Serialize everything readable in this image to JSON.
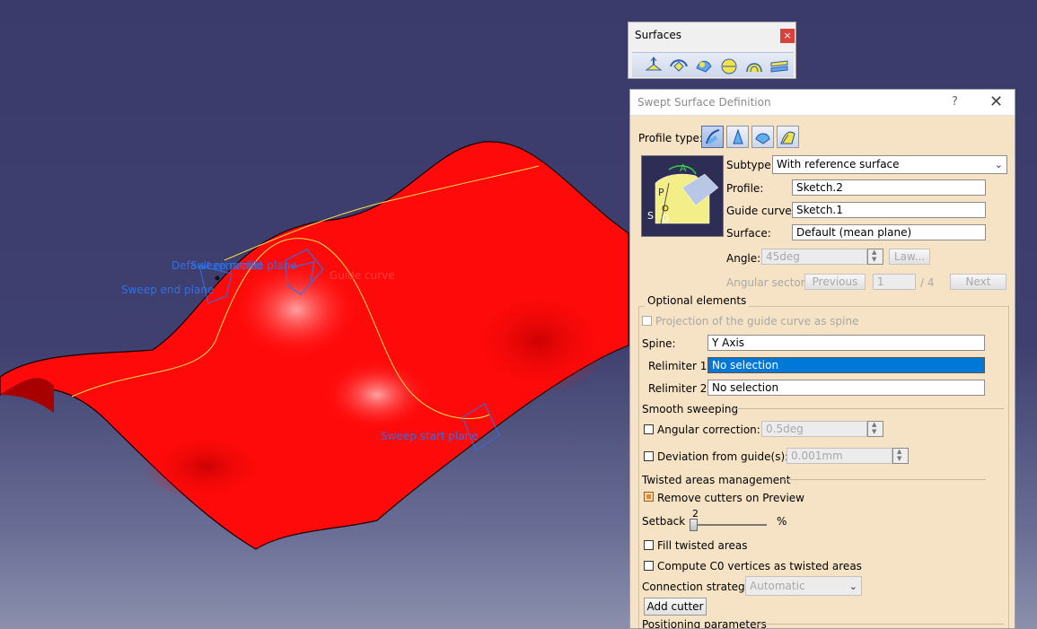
{
  "viewport": {
    "plane_labels": {
      "default_renamed": "Default renamed",
      "sweep_profile_plane": "Sweep profile plane",
      "sweep_end_plane": "Sweep end plane",
      "guide_curve": "Guide curve",
      "sweep_start_plane": "Sweep start plane"
    }
  },
  "toolbar": {
    "title": "Surfaces",
    "close_label": "×",
    "buttons": [
      "extrude-icon",
      "revolve-icon",
      "sphere-icon",
      "sweep-icon",
      "fill-icon",
      "multisection-icon"
    ]
  },
  "dialog": {
    "title": "Swept Surface Definition",
    "help_label": "?",
    "close_label": "✕",
    "profile_type_label": "Profile type:",
    "subtype_label": "Subtype:",
    "subtype_value": "With reference surface",
    "profile_label": "Profile:",
    "profile_value": "Sketch.2",
    "guide_curve_label": "Guide curve:",
    "guide_curve_value": "Sketch.1",
    "surface_label": "Surface:",
    "surface_value": "Default (mean plane)",
    "angle_label": "Angle:",
    "angle_value": "45deg",
    "law_button": "Law...",
    "angular_sector_label": "Angular sector:",
    "previous_button": "Previous",
    "sector_index": "1",
    "sector_total": "/ 4",
    "next_button": "Next",
    "optional_elements_label": "Optional elements",
    "projection_label": "Projection of the guide curve as spine",
    "spine_label": "Spine:",
    "spine_value": "Y Axis",
    "relimiter1_label": "Relimiter 1:",
    "relimiter1_value": "No selection",
    "relimiter2_label": "Relimiter 2:",
    "relimiter2_value": "No selection",
    "smooth_sweeping_label": "Smooth sweeping",
    "angular_correction_label": "Angular correction:",
    "angular_correction_value": "0.5deg",
    "deviation_label": "Deviation from guide(s):",
    "deviation_value": "0.001mm",
    "twisted_areas_label": "Twisted areas management",
    "remove_cutters_label": "Remove cutters on Preview",
    "setback_label": "Setback",
    "setback_value": "2",
    "setback_unit": "%",
    "fill_twisted_label": "Fill twisted areas",
    "compute_c0_label": "Compute C0 vertices as twisted areas",
    "connection_strategy_label": "Connection strategy:",
    "connection_strategy_value": "Automatic",
    "add_cutter_button": "Add cutter",
    "positioning_label": "Positioning parameters",
    "diagram_labels": {
      "a": "A",
      "p": "P",
      "s": "S",
      "g": "G"
    }
  },
  "colors": {
    "surface_red": "#ff0a0a",
    "background_blue": "#3d3d6e",
    "plane_blue": "#2f6fe6",
    "dialog_bg": "#f6e3c5",
    "selection_blue": "#0078d7"
  }
}
